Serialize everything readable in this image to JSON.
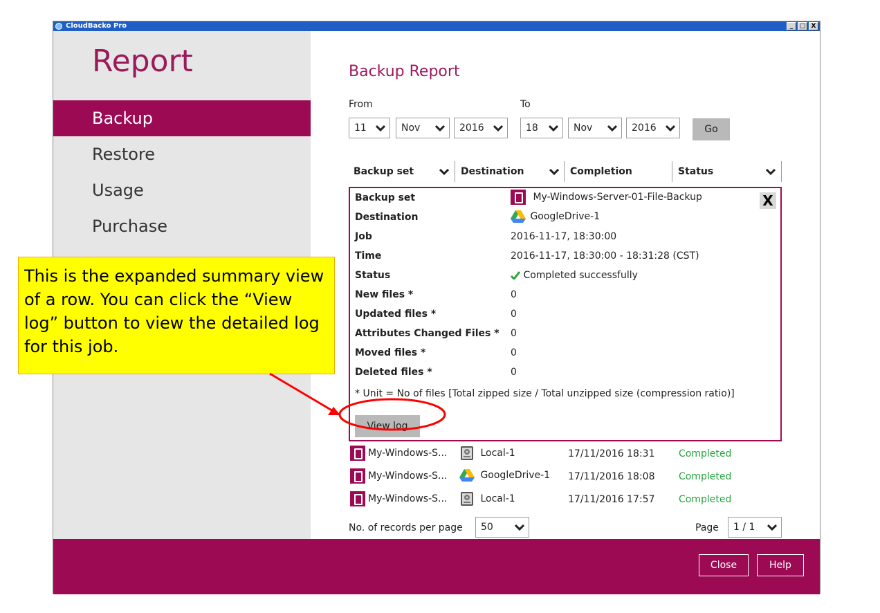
{
  "window": {
    "title": "CloudBacko Pro",
    "ctl_min": "_",
    "ctl_max": "□",
    "ctl_close": "X"
  },
  "sidebar": {
    "title": "Report",
    "items": [
      {
        "label": "Backup",
        "active": true
      },
      {
        "label": "Restore"
      },
      {
        "label": "Usage"
      },
      {
        "label": "Purchase"
      }
    ]
  },
  "main": {
    "title": "Backup Report",
    "from_label": "From",
    "to_label": "To",
    "from": {
      "day": "11",
      "month": "Nov",
      "year": "2016"
    },
    "to": {
      "day": "18",
      "month": "Nov",
      "year": "2016"
    },
    "go_label": "Go",
    "columns": [
      "Backup set",
      "Destination",
      "Completion",
      "Status"
    ]
  },
  "summary": {
    "close_label": "X",
    "backup_set_label": "Backup set",
    "backup_set_value": "My-Windows-Server-01-File-Backup",
    "destination_label": "Destination",
    "destination_value": "GoogleDrive-1",
    "job_label": "Job",
    "job_value": "2016-11-17, 18:30:00",
    "time_label": "Time",
    "time_value": "2016-11-17, 18:30:00 - 18:31:28 (CST)",
    "status_label": "Status",
    "status_value": "Completed successfully",
    "new_files_label": "New files *",
    "new_files_value": "0",
    "updated_files_label": "Updated files *",
    "updated_files_value": "0",
    "attr_files_label": "Attributes Changed Files *",
    "attr_files_value": "0",
    "moved_files_label": "Moved files *",
    "moved_files_value": "0",
    "deleted_files_label": "Deleted files *",
    "deleted_files_value": "0",
    "note": "* Unit = No of files [Total zipped size / Total unzipped size (compression ratio)]",
    "view_log_label": "View log"
  },
  "rows": [
    {
      "backup_set": "My-Windows-S...",
      "destination": "Local-1",
      "dest_icon": "local-drive-icon",
      "completion": "17/11/2016 18:31",
      "status": "Completed"
    },
    {
      "backup_set": "My-Windows-S...",
      "destination": "GoogleDrive-1",
      "dest_icon": "google-drive-icon",
      "completion": "17/11/2016 18:08",
      "status": "Completed"
    },
    {
      "backup_set": "My-Windows-S...",
      "destination": "Local-1",
      "dest_icon": "local-drive-icon",
      "completion": "17/11/2016 17:57",
      "status": "Completed"
    }
  ],
  "pagination": {
    "records_label": "No. of records per page",
    "records_value": "50",
    "page_label": "Page",
    "page_value": "1 / 1"
  },
  "footer": {
    "close_label": "Close",
    "help_label": "Help"
  },
  "callout": {
    "text": "This is the expanded summary view of a row. You can click the “View log” button to view the detailed log for this job."
  },
  "colors": {
    "accent": "#9d0a54",
    "status_green": "#26a43d",
    "callout": "#ffff00",
    "annotation": "#ff0000"
  }
}
